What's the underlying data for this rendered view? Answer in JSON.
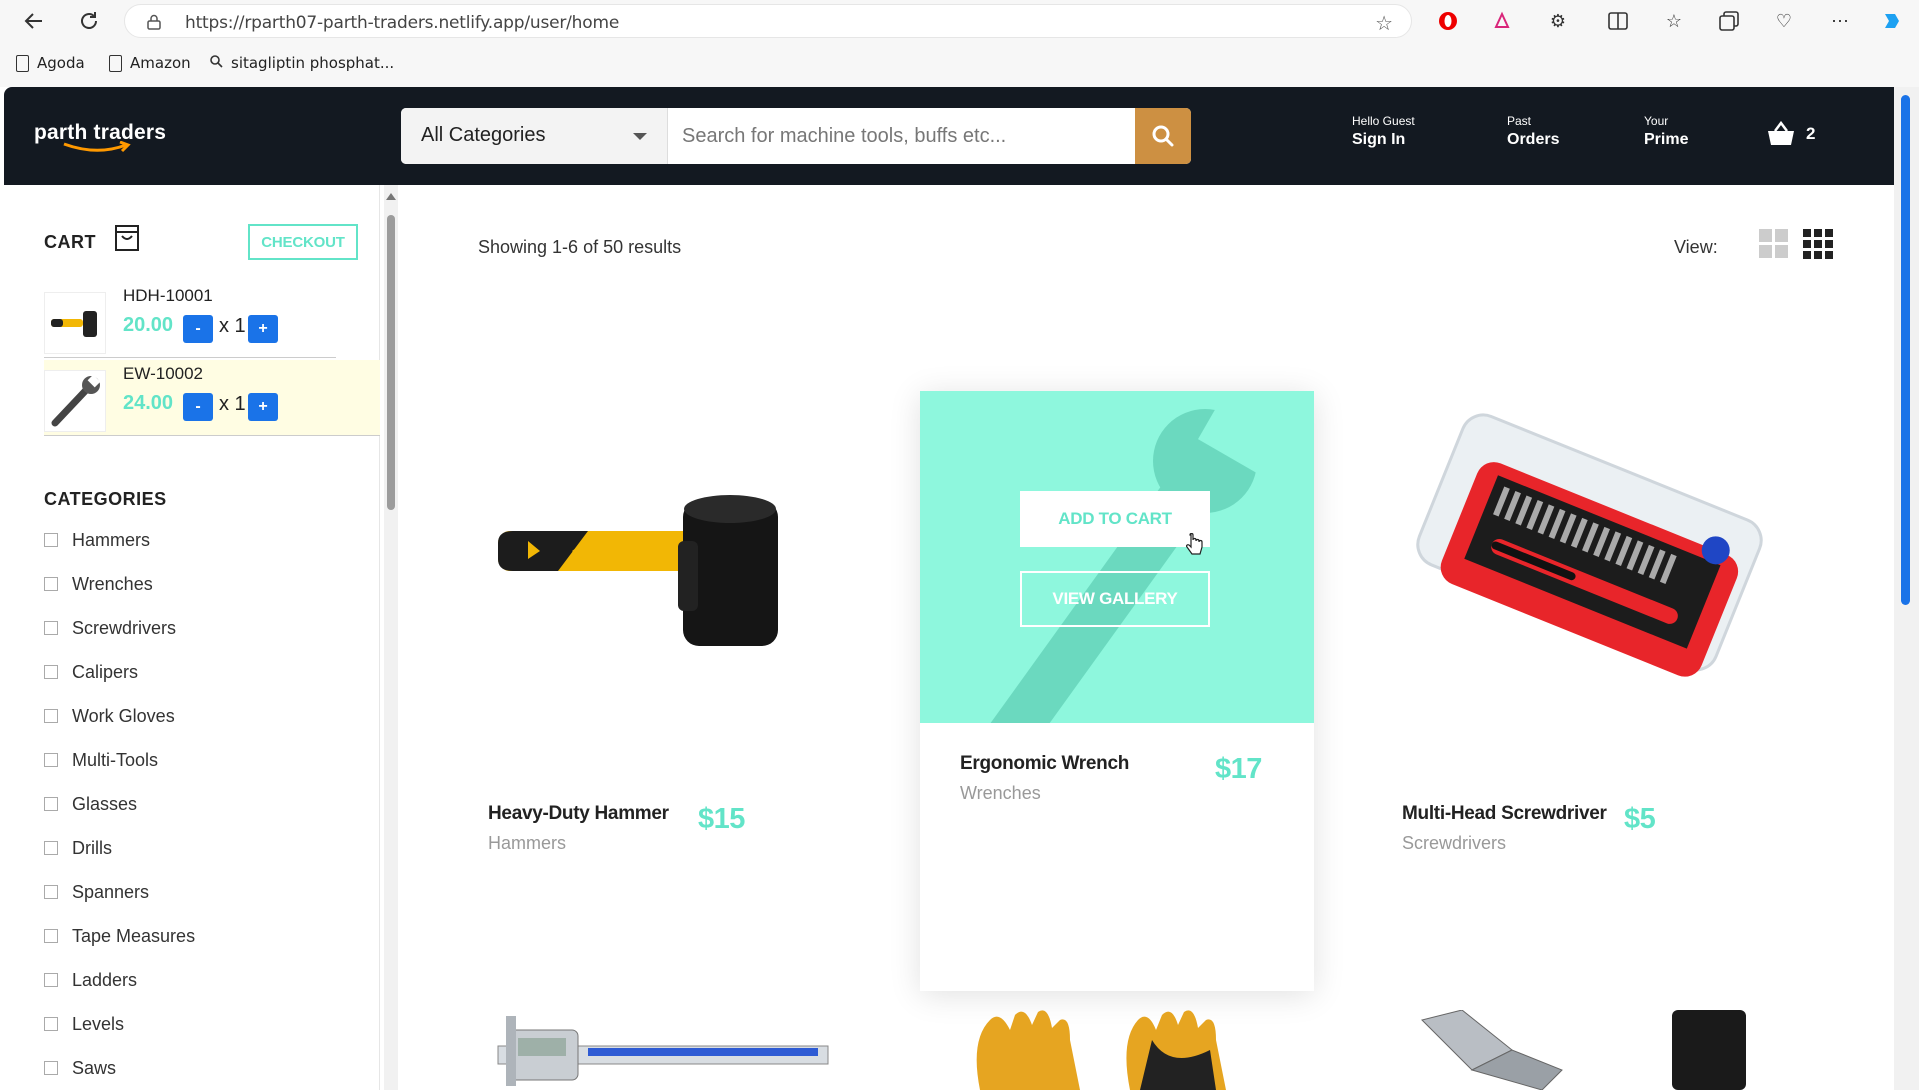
{
  "browser": {
    "url": "https://rparth07-parth-traders.netlify.app/user/home",
    "bookmarks": [
      "Agoda",
      "Amazon",
      "sitagliptin phosphat..."
    ]
  },
  "header": {
    "logo": "parth traders",
    "category_select": "All Categories",
    "search_placeholder": "Search for machine tools, buffs etc...",
    "signin": {
      "line1": "Hello Guest",
      "line2": "Sign In"
    },
    "orders": {
      "line1": "Past",
      "line2": "Orders"
    },
    "prime": {
      "line1": "Your",
      "line2": "Prime"
    },
    "cart_count": "2"
  },
  "sidebar": {
    "cart_title": "CART",
    "checkout_label": "CHECKOUT",
    "cart_items": [
      {
        "code": "HDH-10001",
        "price": "20.00",
        "qty": "x 1",
        "minus": "-",
        "plus": "+"
      },
      {
        "code": "EW-10002",
        "price": "24.00",
        "qty": "x 1",
        "minus": "-",
        "plus": "+"
      }
    ],
    "categories_title": "CATEGORIES",
    "categories": [
      "Hammers",
      "Wrenches",
      "Screwdrivers",
      "Calipers",
      "Work Gloves",
      "Multi-Tools",
      "Glasses",
      "Drills",
      "Spanners",
      "Tape Measures",
      "Ladders",
      "Levels",
      "Saws"
    ]
  },
  "main": {
    "results_text": "Showing 1-6 of 50 results",
    "view_label": "View:",
    "add_to_cart": "ADD TO CART",
    "view_gallery": "VIEW GALLERY",
    "products": [
      {
        "name": "Heavy-Duty Hammer",
        "category": "Hammers",
        "price": "$15"
      },
      {
        "name": "Ergonomic Wrench",
        "category": "Wrenches",
        "price": "$17"
      },
      {
        "name": "Multi-Head Screwdriver",
        "category": "Screwdrivers",
        "price": "$5"
      }
    ]
  },
  "colors": {
    "header_bg": "#131921",
    "accent": "#62e4c8",
    "search_button": "#cd9042",
    "quantity_button": "#1a73e8",
    "hover_overlay": "#8ef7dd"
  }
}
